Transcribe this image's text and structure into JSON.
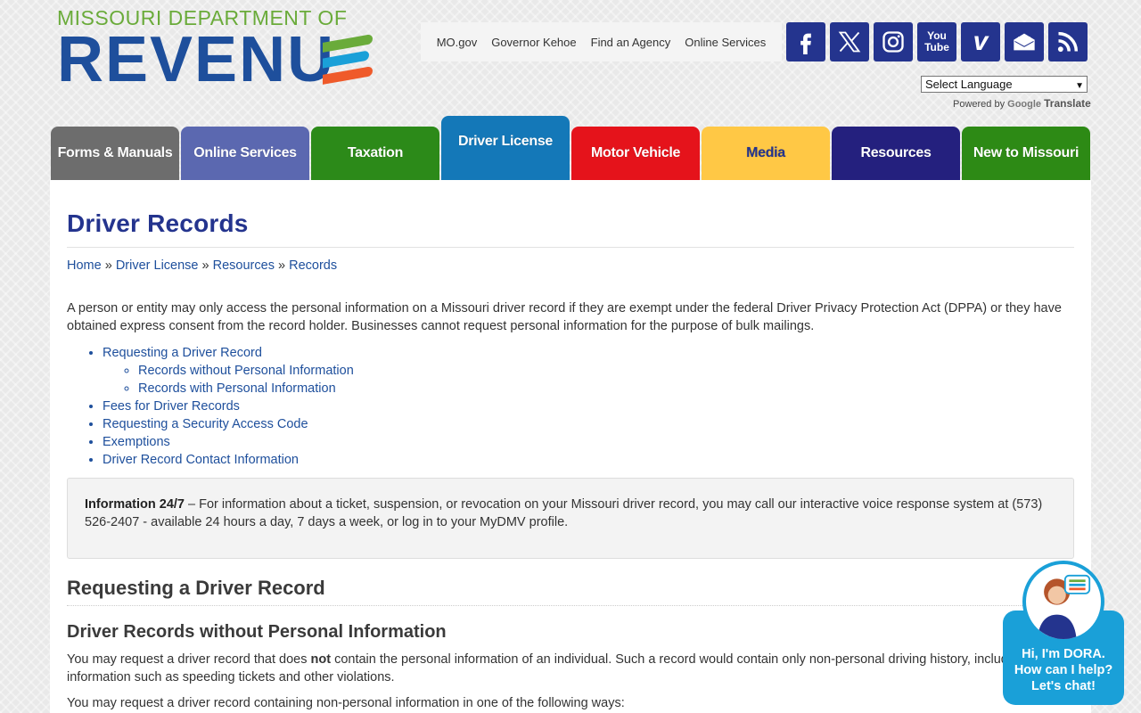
{
  "logo": {
    "top_text": "MISSOURI DEPARTMENT OF",
    "main_text": "REVENU"
  },
  "utility_links": [
    "MO.gov",
    "Governor Kehoe",
    "Find an Agency",
    "Online Services"
  ],
  "social_icons": [
    "facebook-icon",
    "x-twitter-icon",
    "instagram-icon",
    "youtube-icon",
    "vimeo-icon",
    "email-icon",
    "rss-icon"
  ],
  "social_labels": {
    "youtube": "You Tube",
    "vimeo": "v"
  },
  "language": {
    "selected": "Select Language",
    "powered_by": "Powered by",
    "google": "Google",
    "translate": "Translate"
  },
  "nav": [
    {
      "label": "Forms & Manuals",
      "color": "#6d6d6d",
      "text_color": "#ffffff"
    },
    {
      "label": "Online Services",
      "color": "#5b68b0",
      "text_color": "#ffffff"
    },
    {
      "label": "Taxation",
      "color": "#2c8a19",
      "text_color": "#ffffff"
    },
    {
      "label": "Driver License",
      "color": "#1478b8",
      "text_color": "#ffffff",
      "active": true
    },
    {
      "label": "Motor Vehicle",
      "color": "#e5131b",
      "text_color": "#ffffff"
    },
    {
      "label": "Media",
      "color": "#ffc845",
      "text_color": "#24348e"
    },
    {
      "label": "Resources",
      "color": "#24207e",
      "text_color": "#ffffff"
    },
    {
      "label": "New to Missouri",
      "color": "#2d8a15",
      "text_color": "#ffffff"
    }
  ],
  "page": {
    "title": "Driver Records",
    "breadcrumb": [
      "Home",
      "Driver License",
      "Resources",
      "Records"
    ],
    "breadcrumb_sep": "»",
    "intro": "A person or entity may only access the personal information on a Missouri driver record if they are exempt under the federal Driver Privacy Protection Act (DPPA) or they have obtained express consent from the record holder.  Businesses cannot request personal information for the purpose of bulk mailings.",
    "toc": {
      "requesting": "Requesting a Driver Record",
      "without": "Records without Personal Information",
      "with": "Records with Personal Information",
      "fees": "Fees for Driver Records",
      "security": "Requesting a Security Access Code",
      "exemptions": "Exemptions",
      "contact": "Driver Record Contact Information"
    },
    "info_box": {
      "label": "Information 24/7",
      "text": " – For information about a ticket, suspension, or revocation on your Missouri driver record, you may call our interactive voice response system at (573) 526-2407 - available 24 hours a day, 7 days a week, or log in to your MyDMV profile."
    },
    "section_heading": "Requesting a Driver Record",
    "subsection_heading": "Driver Records without Personal Information",
    "para1_a": "You may request a driver record that does ",
    "para1_b": "not",
    "para1_c": " contain the personal information of an individual. Such a record would contain only non-personal driving history, including information such as speeding tickets and other violations.",
    "para2": "You may request a driver record containing non-personal information in one of the following ways:"
  },
  "dora": {
    "line1": "Hi, I'm DORA.",
    "line2": "How can I help?",
    "line3": "Let's chat!"
  }
}
